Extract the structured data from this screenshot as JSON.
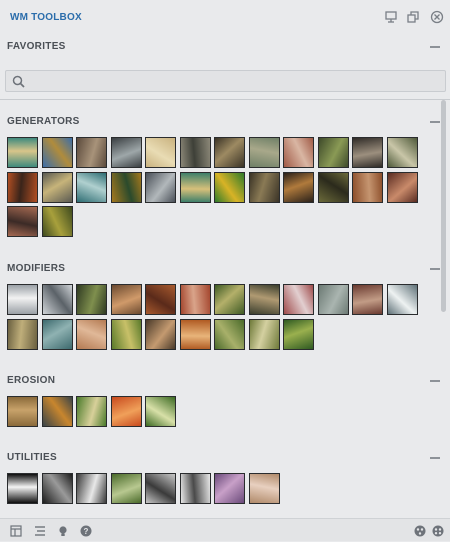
{
  "window": {
    "title": "WM TOOLBOX"
  },
  "favorites": {
    "label": "FAVORITES",
    "search_placeholder": ""
  },
  "sections": [
    {
      "id": "generators",
      "label": "GENERATORS",
      "nodes": [
        {
          "c1": "#3f8a7d",
          "c2": "#d8c58a"
        },
        {
          "c1": "#3c6ea8",
          "c2": "#b08c3c"
        },
        {
          "c1": "#5b4a3c",
          "c2": "#a8937a"
        },
        {
          "c1": "#3a3f42",
          "c2": "#9ea7a9"
        },
        {
          "c1": "#c9b27f",
          "c2": "#e9dcb4"
        },
        {
          "c1": "#8c8878",
          "c2": "#3e4038"
        },
        {
          "c1": "#3a3326",
          "c2": "#9d8a62"
        },
        {
          "c1": "#6f8067",
          "c2": "#a8a88a"
        },
        {
          "c1": "#a05a46",
          "c2": "#d9b6a3"
        },
        {
          "c1": "#3e4a2a",
          "c2": "#8a9a55"
        },
        {
          "c1": "#302c28",
          "c2": "#9c8f7e"
        },
        {
          "c1": "#4f5a3a",
          "c2": "#c9c6a8"
        },
        {
          "c1": "#b34f22",
          "c2": "#3a241a"
        },
        {
          "c1": "#5a5a52",
          "c2": "#c7b47a"
        },
        {
          "c1": "#2e6d73",
          "c2": "#b0d0cf"
        },
        {
          "c1": "#a4781e",
          "c2": "#2a4a2c"
        },
        {
          "c1": "#4a5058",
          "c2": "#b2b8bb"
        },
        {
          "c1": "#3c7f6a",
          "c2": "#d7c07a"
        },
        {
          "c1": "#2d7a2a",
          "c2": "#d8b326"
        },
        {
          "c1": "#3b3427",
          "c2": "#8a7a55"
        },
        {
          "c1": "#2a211a",
          "c2": "#b07a3c"
        },
        {
          "c1": "#6b6a3a",
          "c2": "#2b2a1c"
        },
        {
          "c1": "#8c4e2a",
          "c2": "#c59570"
        },
        {
          "c1": "#5a2c22",
          "c2": "#c98a6a"
        },
        {
          "c1": "#a66a52",
          "c2": "#3b2a26"
        },
        {
          "c1": "#3e4a1e",
          "c2": "#a8a03c"
        }
      ]
    },
    {
      "id": "modifiers",
      "label": "MODIFIERS",
      "nodes": [
        {
          "c1": "#9aa0a6",
          "c2": "#f2f2f2"
        },
        {
          "c1": "#d0d4d8",
          "c2": "#5b6268"
        },
        {
          "c1": "#2f3a22",
          "c2": "#7f8f4e"
        },
        {
          "c1": "#6b4a30",
          "c2": "#d09a6a"
        },
        {
          "c1": "#a85a2e",
          "c2": "#5a2a1a"
        },
        {
          "c1": "#a4462e",
          "c2": "#d9a48a"
        },
        {
          "c1": "#3e5a24",
          "c2": "#b4b06a"
        },
        {
          "c1": "#3b3f2e",
          "c2": "#b09a72"
        },
        {
          "c1": "#9e4a4a",
          "c2": "#e2cfd0"
        },
        {
          "c1": "#6c7a74",
          "c2": "#aab5b0"
        },
        {
          "c1": "#6a3a30",
          "c2": "#c29c86"
        },
        {
          "c1": "#5f7178",
          "c2": "#eef2f2"
        },
        {
          "c1": "#6a6040",
          "c2": "#bfae7a"
        },
        {
          "c1": "#3d6a6e",
          "c2": "#8fb2b2"
        },
        {
          "c1": "#b47a52",
          "c2": "#e0b898"
        },
        {
          "c1": "#5a7a2a",
          "c2": "#c8c068"
        },
        {
          "c1": "#4a3a2a",
          "c2": "#c49a70"
        },
        {
          "c1": "#b05a22",
          "c2": "#e8b47a"
        },
        {
          "c1": "#4a6a2a",
          "c2": "#a8b06a"
        },
        {
          "c1": "#6f7a3a",
          "c2": "#d4d0a0"
        },
        {
          "c1": "#2f5a22",
          "c2": "#9ab04e"
        }
      ]
    },
    {
      "id": "erosion",
      "label": "EROSION",
      "nodes": [
        {
          "c1": "#8a6a3a",
          "c2": "#c8a26a"
        },
        {
          "c1": "#3a4448",
          "c2": "#c8862e"
        },
        {
          "c1": "#4a7a2a",
          "c2": "#d8d09a"
        },
        {
          "c1": "#c84a1e",
          "c2": "#f0a05a"
        },
        {
          "c1": "#3c6a22",
          "c2": "#d8e0a8"
        }
      ]
    },
    {
      "id": "utilities",
      "label": "UTILITIES",
      "nodes": [
        {
          "c1": "#0e0e0e",
          "c2": "#f4f4f4"
        },
        {
          "c1": "#1c1c1c",
          "c2": "#9a9a9a"
        },
        {
          "c1": "#3a3a3a",
          "c2": "#e8e8e8"
        },
        {
          "c1": "#4a6a2a",
          "c2": "#b8c890"
        },
        {
          "c1": "#c8c8c8",
          "c2": "#3a3a3a"
        },
        {
          "c1": "#e8e8e8",
          "c2": "#4a4a4a"
        },
        {
          "c1": "#6a4a7a",
          "c2": "#c8a0c8"
        },
        {
          "c1": "#b08a6a",
          "c2": "#e8d0c0"
        }
      ]
    }
  ],
  "colors": {
    "accent": "#2b6dab",
    "panel_bg": "#e9eaec"
  },
  "icons": {
    "window": [
      "monitor-icon",
      "restore-icon",
      "close-icon"
    ],
    "footer_left": [
      "layout-icon",
      "list-icon",
      "lightbulb-icon",
      "help-icon"
    ],
    "footer_right": [
      "settings-icon",
      "globe-icon"
    ]
  }
}
